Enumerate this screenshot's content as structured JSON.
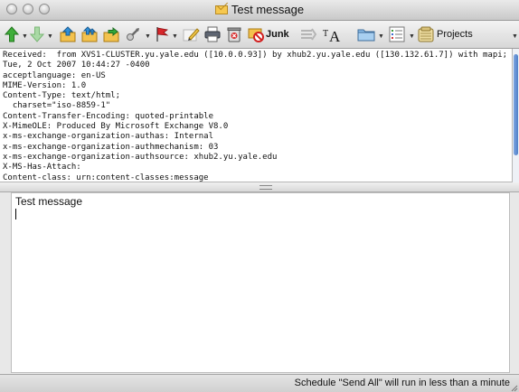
{
  "window": {
    "title": "Test message"
  },
  "toolbar": {
    "junk_label": "Junk",
    "projects_label": "Projects"
  },
  "headers": [
    "Received:  from XVS1-CLUSTER.yu.yale.edu ([10.0.0.93]) by xhub2.yu.yale.edu ([130.132.61.7]) with mapi;",
    "Tue, 2 Oct 2007 10:44:27 -0400",
    "acceptlanguage: en-US",
    "MIME-Version: 1.0",
    "Content-Type: text/html;",
    "  charset=\"iso-8859-1\"",
    "Content-Transfer-Encoding: quoted-printable",
    "X-MimeOLE: Produced By Microsoft Exchange V8.0",
    "x-ms-exchange-organization-authas: Internal",
    "x-ms-exchange-organization-authmechanism: 03",
    "x-ms-exchange-organization-authsource: xhub2.yu.yale.edu",
    "X-MS-Has-Attach:",
    "Content-class: urn:content-classes:message"
  ],
  "message": {
    "body": "Test message"
  },
  "status": {
    "text": "Schedule \"Send All\" will run in less than a minute"
  }
}
